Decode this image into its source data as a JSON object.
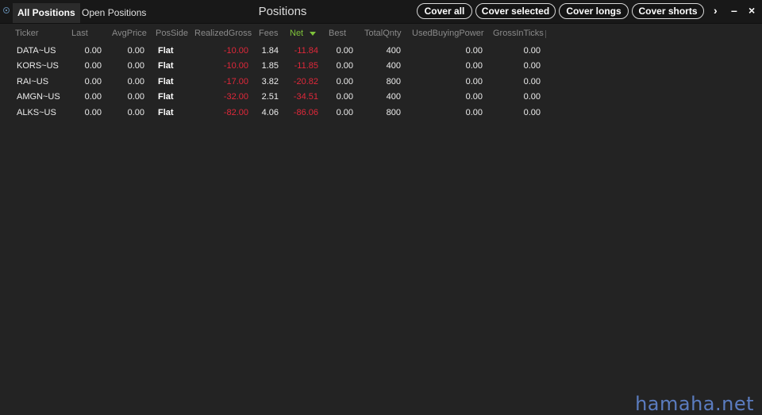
{
  "window": {
    "title": "Positions",
    "tabs": [
      {
        "label": "All Positions",
        "active": true
      },
      {
        "label": "Open Positions",
        "active": false
      }
    ],
    "buttons": {
      "cover_all": "Cover all",
      "cover_selected": "Cover selected",
      "cover_longs": "Cover longs",
      "cover_shorts": "Cover shorts"
    },
    "controls": {
      "more": "›",
      "minimize": "–",
      "close": "×"
    }
  },
  "table": {
    "columns": [
      "Ticker",
      "Last",
      "AvgPrice",
      "PosSide",
      "RealizedGross",
      "Fees",
      "Net",
      "Best",
      "TotalQnty",
      "UsedBuyingPower",
      "GrossInTicks"
    ],
    "sorted_column": "Net",
    "rows": [
      [
        "DATA~US",
        "0.00",
        "0.00",
        "Flat",
        "-10.00",
        "1.84",
        "-11.84",
        "0.00",
        "400",
        "0.00",
        "0.00"
      ],
      [
        "KORS~US",
        "0.00",
        "0.00",
        "Flat",
        "-10.00",
        "1.85",
        "-11.85",
        "0.00",
        "400",
        "0.00",
        "0.00"
      ],
      [
        "RAI~US",
        "0.00",
        "0.00",
        "Flat",
        "-17.00",
        "3.82",
        "-20.82",
        "0.00",
        "800",
        "0.00",
        "0.00"
      ],
      [
        "AMGN~US",
        "0.00",
        "0.00",
        "Flat",
        "-32.00",
        "2.51",
        "-34.51",
        "0.00",
        "400",
        "0.00",
        "0.00"
      ],
      [
        "ALKS~US",
        "0.00",
        "0.00",
        "Flat",
        "-82.00",
        "4.06",
        "-86.06",
        "0.00",
        "800",
        "0.00",
        "0.00"
      ]
    ]
  },
  "colors": {
    "negative": "#e0283a",
    "sorted_header": "#7ec23a",
    "background": "#232323"
  },
  "watermark": "hamaha.net"
}
